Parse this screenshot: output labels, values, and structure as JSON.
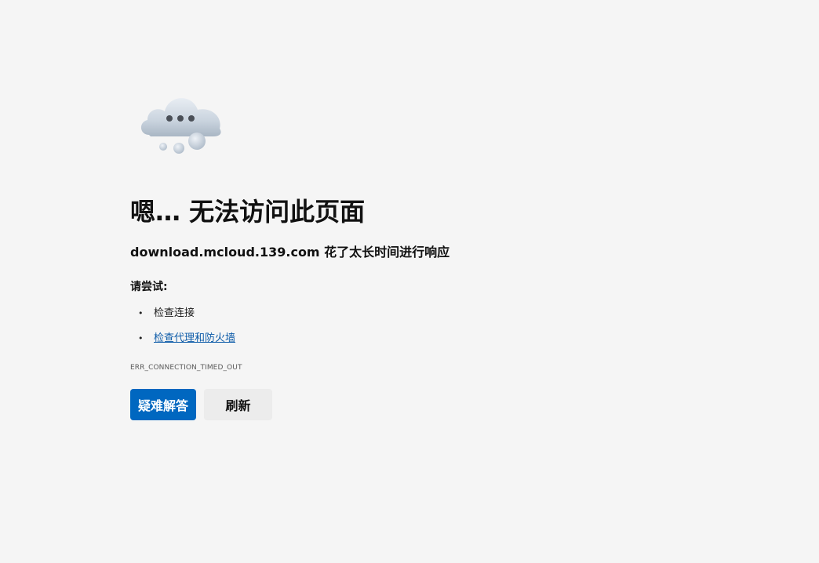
{
  "error_page": {
    "title": "嗯… 无法访问此页面",
    "subtitle": "download.mcloud.139.com 花了太长时间进行响应",
    "try_label": "请尝试:",
    "suggestions": [
      {
        "label": "检查连接",
        "is_link": false
      },
      {
        "label": "检查代理和防火墙",
        "is_link": true
      }
    ],
    "error_code": "ERR_CONNECTION_TIMED_OUT",
    "buttons": {
      "troubleshoot_label": "疑难解答",
      "refresh_label": "刷新"
    },
    "illustration": "cloud-ellipsis-icon"
  },
  "colors": {
    "background": "#f5f5f5",
    "primary_button": "#0067c0",
    "secondary_button": "#ececec",
    "link": "#0b5aa8"
  }
}
